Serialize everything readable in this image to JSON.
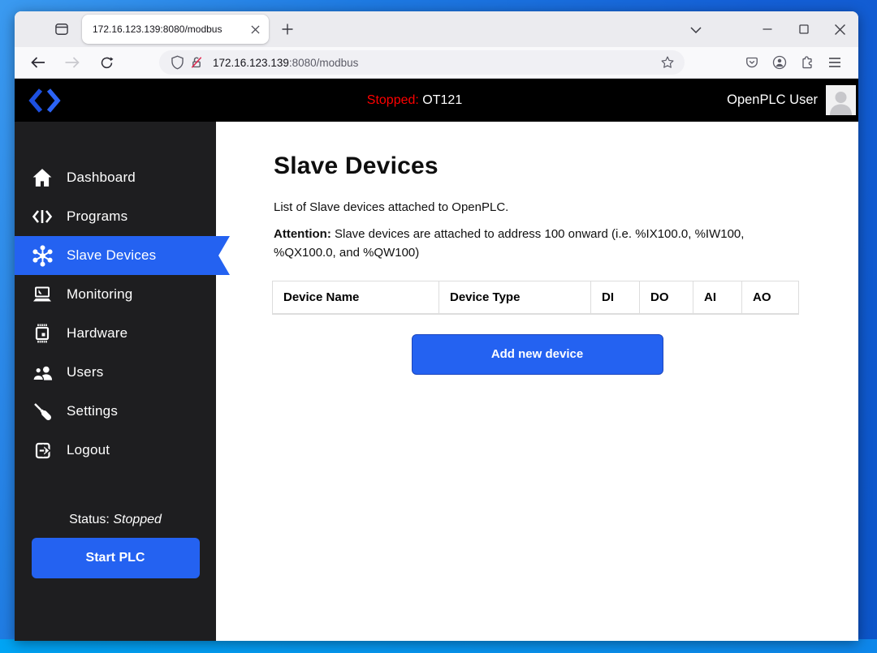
{
  "browser": {
    "tab_title": "172.16.123.139:8080/modbus",
    "url": {
      "host": "172.16.123.139",
      "path": ":8080/modbus"
    }
  },
  "app_header": {
    "status_label": "Stopped:",
    "status_value": "OT121",
    "user_name": "OpenPLC User"
  },
  "sidebar": {
    "items": [
      {
        "label": "Dashboard",
        "icon": "home-icon"
      },
      {
        "label": "Programs",
        "icon": "code-icon"
      },
      {
        "label": "Slave Devices",
        "icon": "hub-icon",
        "selected": true
      },
      {
        "label": "Monitoring",
        "icon": "laptop-icon"
      },
      {
        "label": "Hardware",
        "icon": "chip-icon"
      },
      {
        "label": "Users",
        "icon": "users-icon"
      },
      {
        "label": "Settings",
        "icon": "screwdriver-icon"
      },
      {
        "label": "Logout",
        "icon": "logout-icon"
      }
    ],
    "status_label": "Status:",
    "status_value": "Stopped",
    "start_button": "Start PLC"
  },
  "main": {
    "title": "Slave Devices",
    "intro": "List of Slave devices attached to OpenPLC.",
    "attention_label": "Attention:",
    "attention_text": "Slave devices are attached to address 100 onward (i.e. %IX100.0, %IW100, %QX100.0, and %QW100)",
    "table_headers": [
      "Device Name",
      "Device Type",
      "DI",
      "DO",
      "AI",
      "AO"
    ],
    "add_button": "Add new device"
  },
  "colors": {
    "accent_blue": "#2462f1",
    "status_red": "#ff0000",
    "sidebar_bg": "#1e1e20",
    "header_bg": "#000000"
  }
}
